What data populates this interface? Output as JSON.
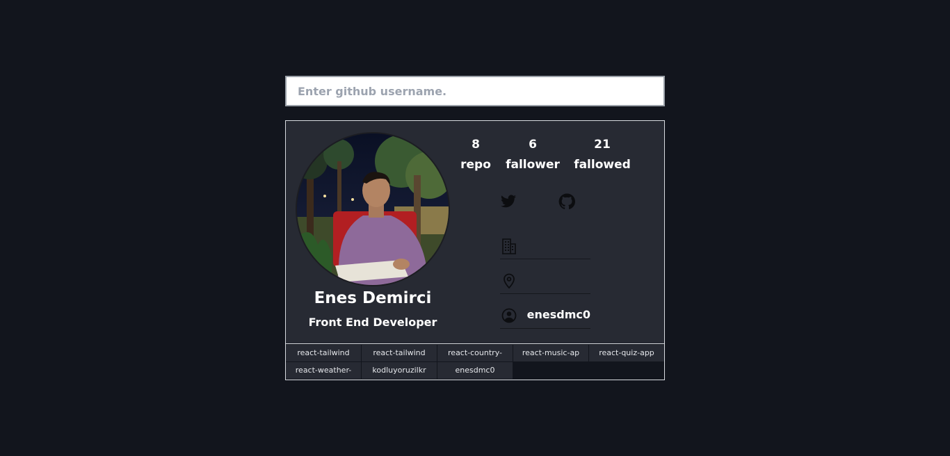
{
  "search": {
    "placeholder": "Enter github username.",
    "value": ""
  },
  "profile": {
    "name": "Enes Demirci",
    "bio": "Front End Developer",
    "stats": [
      {
        "value": "8",
        "label": "repo"
      },
      {
        "value": "6",
        "label": "fallower"
      },
      {
        "value": "21",
        "label": "fallowed"
      }
    ],
    "social": [
      {
        "icon": "twitter-icon"
      },
      {
        "icon": "github-icon"
      }
    ],
    "info": {
      "company": "",
      "location": "",
      "login": "enesdmc0"
    }
  },
  "repos": [
    "react-tailwind",
    "react-tailwind",
    "react-country-",
    "react-music-ap",
    "react-quiz-app",
    "react-weather-",
    "kodluyoruzilkr",
    "enesdmc0"
  ],
  "colors": {
    "page_bg": "#12151d",
    "card_bg": "#272a33",
    "text": "#ffffff",
    "border": "#d9dce1"
  }
}
